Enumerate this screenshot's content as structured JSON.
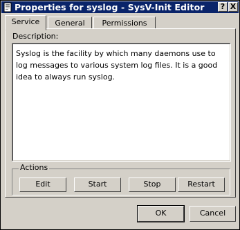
{
  "window": {
    "title": "Properties for syslog - SysV-Init Editor",
    "help_button": "?",
    "close_button": "X"
  },
  "tabs": [
    {
      "label": "Service",
      "active": true
    },
    {
      "label": "General",
      "active": false
    },
    {
      "label": "Permissions",
      "active": false
    }
  ],
  "service": {
    "description_label": "Description:",
    "description_text": "Syslog is the facility by which many daemons use to log messages to various system log files. It is a good idea to always run syslog.",
    "actions_label": "Actions",
    "actions": [
      {
        "label": "Edit"
      },
      {
        "label": "Start"
      },
      {
        "label": "Stop"
      },
      {
        "label": "Restart"
      }
    ]
  },
  "dialog_buttons": {
    "ok": "OK",
    "cancel": "Cancel"
  },
  "colors": {
    "titlebar": "#0a246a",
    "face": "#d4d0c8"
  }
}
